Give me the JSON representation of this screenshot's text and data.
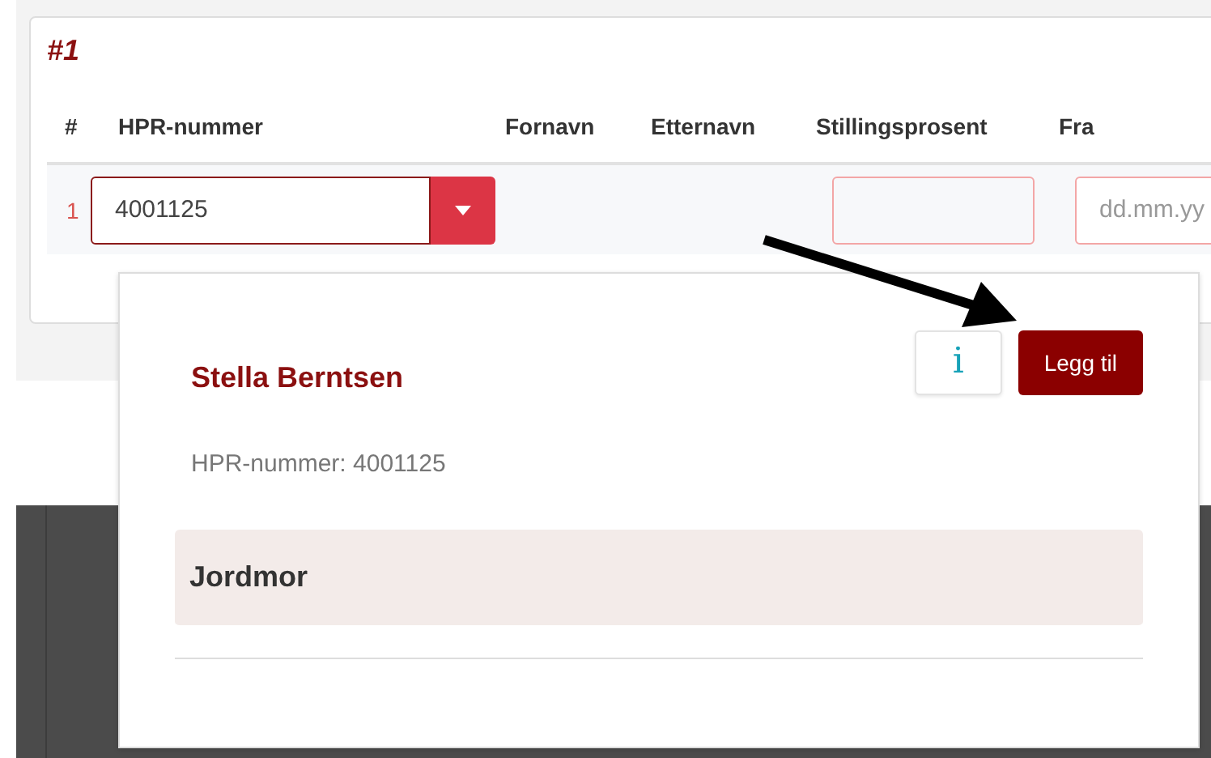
{
  "section": {
    "title": "#1"
  },
  "table": {
    "columns": [
      "#",
      "HPR-nummer",
      "Fornavn",
      "Etternavn",
      "Stillingsprosent",
      "Fra"
    ],
    "rows": [
      {
        "index": "1",
        "hpr_value": "4001125",
        "fra_placeholder": "dd.mm.yy"
      }
    ]
  },
  "popover": {
    "name": "Stella Berntsen",
    "info_button": "i",
    "add_button": "Legg til",
    "hpr_line": "HPR-nummer: 4001125",
    "items": [
      {
        "label": "Jordmor",
        "selected": true
      }
    ]
  }
}
